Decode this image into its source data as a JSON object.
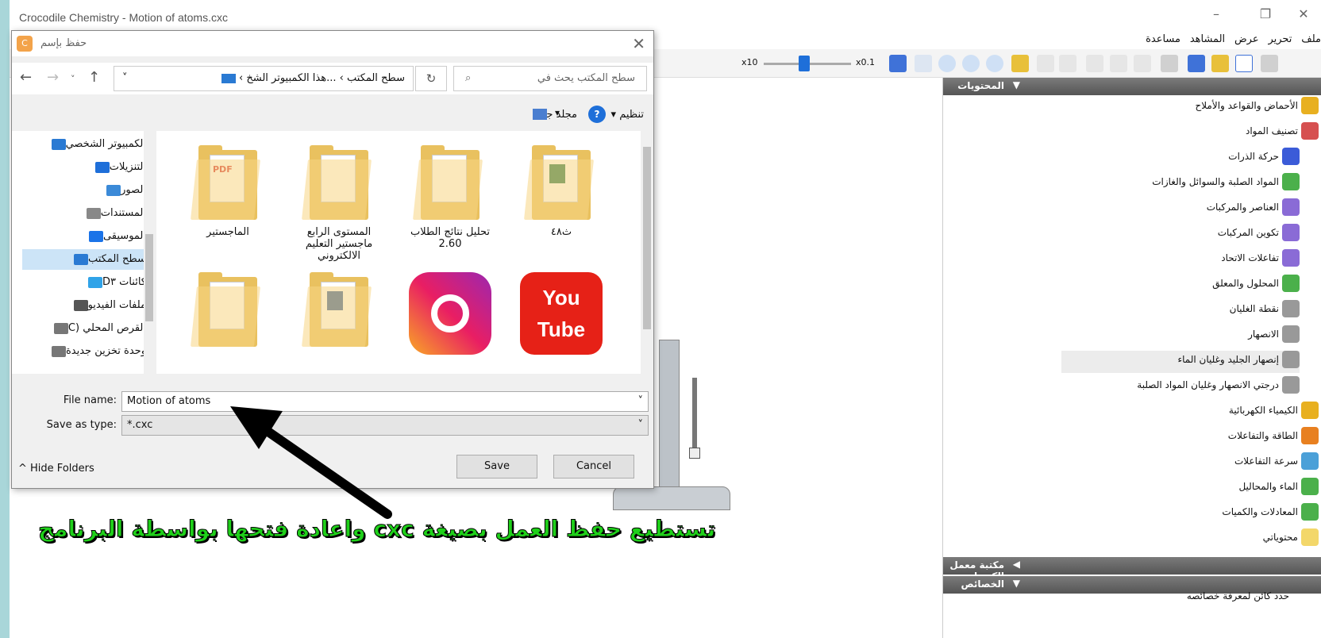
{
  "window": {
    "title": "Crocodile Chemistry - Motion of atoms.cxc"
  },
  "menubar": {
    "items": [
      "ملف",
      "تحرير",
      "عرض",
      "المشاهد",
      "مساعدة"
    ]
  },
  "toolbar": {
    "zoom_left_label": "x10",
    "zoom_right_label": "x0.1"
  },
  "dialog": {
    "title": "حفظ بإسم",
    "breadcrumb": [
      "سطح المكتب",
      "...هذا الكمبيوتر الشخ"
    ],
    "search_placeholder": "سطح المكتب يحث في",
    "organize_label": "تنظيم",
    "new_folder_label": "مجلد جديد",
    "nav_items": [
      {
        "label": "الكمبيوتر الشخصي",
        "icon": "computer-icon",
        "color": "#2a7ad3"
      },
      {
        "label": "التنزيلات",
        "icon": "download-icon",
        "color": "#1e6fd9"
      },
      {
        "label": "الصور",
        "icon": "pictures-icon",
        "color": "#3b8ad8"
      },
      {
        "label": "المستندات",
        "icon": "documents-icon",
        "color": "#888888"
      },
      {
        "label": "الموسيقى",
        "icon": "music-icon",
        "color": "#1a73e8"
      },
      {
        "label": "سطح المكتب",
        "icon": "desktop-icon",
        "color": "#2a7ad3"
      },
      {
        "label": "كائنات D۳",
        "icon": "3d-objects-icon",
        "color": "#30a3e8"
      },
      {
        "label": "ملفات الفيديو",
        "icon": "video-icon",
        "color": "#555555"
      },
      {
        "label": "القرص المحلي (C",
        "icon": "drive-icon",
        "color": "#777777"
      },
      {
        "label": "وحدة تخزين جديدة",
        "icon": "drive-icon",
        "color": "#777777"
      }
    ],
    "files": [
      {
        "label": "ث٤٨",
        "type": "folder-excel"
      },
      {
        "label": "تحليل نتائج الطلاب 2.60",
        "type": "folder"
      },
      {
        "label": "المستوى الرابع ماجستير التعليم الالكتروني",
        "type": "folder"
      },
      {
        "label": "الماجستير",
        "type": "folder-pdf"
      },
      {
        "label": "",
        "type": "youtube-shortcut"
      },
      {
        "label": "",
        "type": "instagram-shortcut"
      },
      {
        "label": "",
        "type": "folder-word"
      },
      {
        "label": "",
        "type": "folder"
      }
    ],
    "file_name_label": "File name:",
    "file_name_value": "Motion of atoms",
    "save_type_label": "Save as type:",
    "save_type_value": "*.cxc",
    "hide_folders_label": "Hide Folders",
    "save_label": "Save",
    "cancel_label": "Cancel"
  },
  "panel": {
    "contents_header": "المحتويات",
    "items": [
      {
        "label": "الأحماض والقواعد والأملاح",
        "indent": 0,
        "color": "#e8b020"
      },
      {
        "label": "تصنيف المواد",
        "indent": 0,
        "color": "#d65050"
      },
      {
        "label": "حركة الذرات",
        "indent": 1,
        "color": "#3b5bd8"
      },
      {
        "label": "المواد الصلبة والسوائل والغازات",
        "indent": 1,
        "color": "#4bb04b"
      },
      {
        "label": "العناصر والمركبات",
        "indent": 1,
        "color": "#8a6bd6"
      },
      {
        "label": "تكوين المركبات",
        "indent": 1,
        "color": "#8a6bd6"
      },
      {
        "label": "تفاعلات الاتحاد",
        "indent": 1,
        "color": "#8a6bd6"
      },
      {
        "label": "المحلول والمعلق",
        "indent": 1,
        "color": "#4bb04b"
      },
      {
        "label": "نقطة الغليان",
        "indent": 1,
        "color": "#999999"
      },
      {
        "label": "الانصهار",
        "indent": 1,
        "color": "#999999"
      },
      {
        "label": "إنصهار الجليد وغليان الماء",
        "indent": 1,
        "color": "#999999",
        "selected": true
      },
      {
        "label": "درجتي الانصهار وغليان المواد الصلبة",
        "indent": 1,
        "color": "#999999"
      },
      {
        "label": "الكيمياء الكهربائية",
        "indent": 0,
        "color": "#e8b020"
      },
      {
        "label": "الطاقة والتفاعلات",
        "indent": 0,
        "color": "#e88020"
      },
      {
        "label": "سرعة التفاعلات",
        "indent": 0,
        "color": "#4ba0d8"
      },
      {
        "label": "الماء والمحاليل",
        "indent": 0,
        "color": "#4bb04b"
      },
      {
        "label": "المعادلات والكميات",
        "indent": 0,
        "color": "#4bb04b"
      },
      {
        "label": "محتوياتي",
        "indent": 0,
        "color": "#f3d76a"
      }
    ],
    "library_header": "مكتبة معمل الكيمياء",
    "properties_header": "الخصائص",
    "hint": "حدد كائن لمعرفة خصائصه"
  },
  "annotation": {
    "caption": "تستطيع حفظ العمل بصيغة cxc واعادة فتحها بواسطة البرنامج"
  }
}
